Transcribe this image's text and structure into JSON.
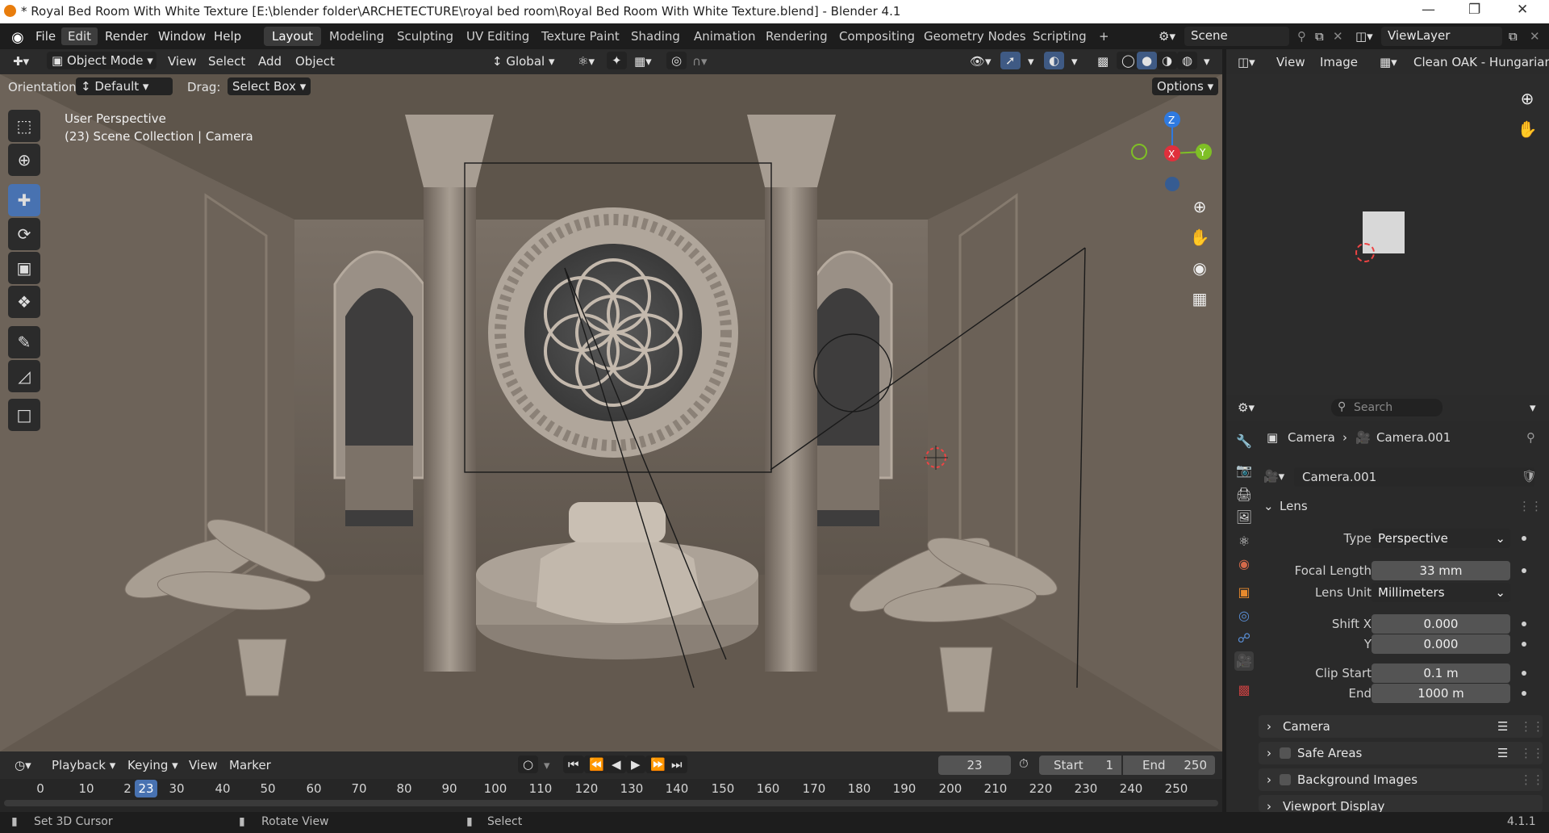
{
  "window": {
    "title": "* Royal Bed Room With White Texture [E:\\blender folder\\ARCHETECTURE\\royal bed room\\Royal Bed Room With White Texture.blend] - Blender 4.1"
  },
  "menu": {
    "items": [
      "File",
      "Edit",
      "Render",
      "Window",
      "Help"
    ],
    "active_menu": "Edit",
    "workspaces": [
      "Layout",
      "Modeling",
      "Sculpting",
      "UV Editing",
      "Texture Paint",
      "Shading",
      "Animation",
      "Rendering",
      "Compositing",
      "Geometry Nodes",
      "Scripting"
    ],
    "active_workspace": "Layout",
    "add_tab": "+",
    "scene": "Scene",
    "view_layer": "ViewLayer"
  },
  "viewport_header": {
    "mode": "Object Mode",
    "view": "View",
    "select": "Select",
    "add": "Add",
    "object": "Object",
    "transform_orientation": "Global",
    "orientation_label": "Orientation:",
    "orientation_value": "Default",
    "drag_label": "Drag:",
    "drag_value": "Select Box",
    "options": "Options"
  },
  "viewport": {
    "perspective": "User Perspective",
    "collection": "(23) Scene Collection | Camera",
    "gizmo": {
      "x": "X",
      "y": "Y",
      "z": "Z"
    },
    "colors": {
      "x": "#e0303c",
      "y": "#7fbf26",
      "z": "#2f7ae0",
      "bg": "#5e554c"
    }
  },
  "image_editor": {
    "view": "View",
    "image": "Image",
    "image_name": "Clean OAK - Hungarian_H"
  },
  "properties": {
    "search_placeholder": "Search",
    "breadcrumb_object": "Camera",
    "breadcrumb_data": "Camera.001",
    "data_name": "Camera.001",
    "lens_panel": "Lens",
    "type_label": "Type",
    "type_value": "Perspective",
    "focal_label": "Focal Length",
    "focal_value": "33 mm",
    "lens_unit_label": "Lens Unit",
    "lens_unit_value": "Millimeters",
    "shift_x_label": "Shift X",
    "shift_x_value": "0.000",
    "shift_y_label": "Y",
    "shift_y_value": "0.000",
    "clip_start_label": "Clip Start",
    "clip_start_value": "0.1 m",
    "clip_end_label": "End",
    "clip_end_value": "1000 m",
    "panels": [
      "Camera",
      "Safe Areas",
      "Background Images",
      "Viewport Display"
    ]
  },
  "timeline": {
    "playback": "Playback",
    "keying": "Keying",
    "view": "View",
    "marker": "Marker",
    "current_frame": "23",
    "start_label": "Start",
    "start_value": "1",
    "end_label": "End",
    "end_value": "250",
    "ticks": [
      "0",
      "10",
      "2",
      "30",
      "40",
      "50",
      "60",
      "70",
      "80",
      "90",
      "100",
      "110",
      "120",
      "130",
      "140",
      "150",
      "160",
      "170",
      "180",
      "190",
      "200",
      "210",
      "220",
      "230",
      "240",
      "250"
    ],
    "playhead_label": "23"
  },
  "status": {
    "left": "Set 3D Cursor",
    "middle": "Rotate View",
    "right": "Select",
    "version": "4.1.1"
  }
}
